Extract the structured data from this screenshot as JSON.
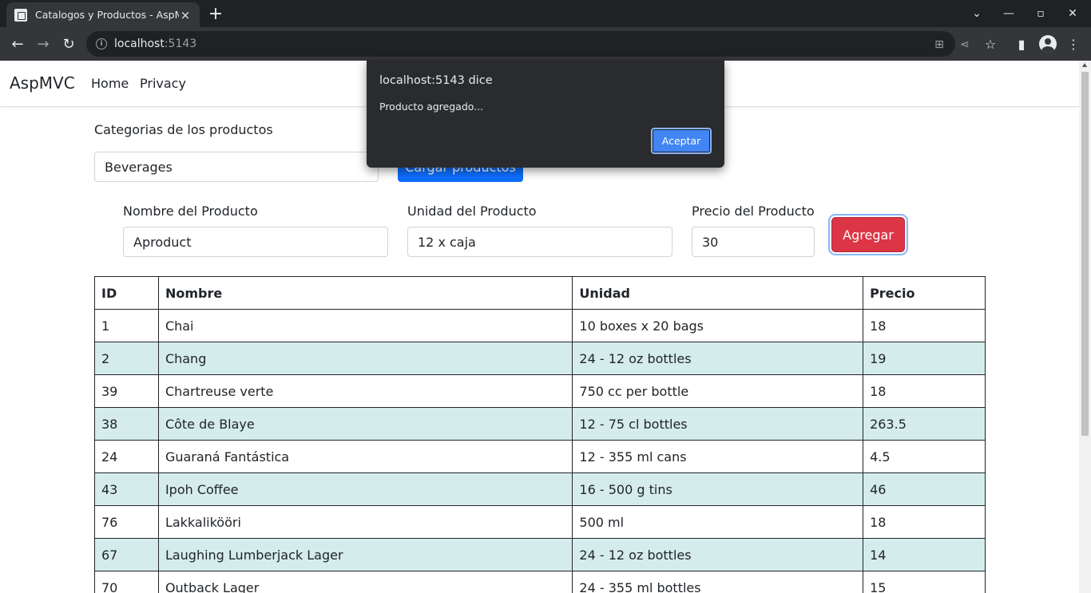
{
  "browser": {
    "tab_title": "Catalogos y Productos - AspMVC",
    "url_host": "localhost",
    "url_port": ":5143",
    "new_tab_symbol": "+",
    "tab_close_symbol": "×"
  },
  "navbar": {
    "brand": "AspMVC",
    "links": [
      "Home",
      "Privacy"
    ]
  },
  "category": {
    "label": "Categorias de los productos",
    "selected": "Beverages",
    "load_button": "Cargar productos"
  },
  "form": {
    "name_label": "Nombre del Producto",
    "name_value": "Aproduct",
    "unit_label": "Unidad del Producto",
    "unit_value": "12 x caja",
    "price_label": "Precio del Producto",
    "price_value": "30",
    "add_button": "Agregar"
  },
  "table": {
    "headers": [
      "ID",
      "Nombre",
      "Unidad",
      "Precio"
    ],
    "rows": [
      [
        "1",
        "Chai",
        "10 boxes x 20 bags",
        "18"
      ],
      [
        "2",
        "Chang",
        "24 - 12 oz bottles",
        "19"
      ],
      [
        "39",
        "Chartreuse verte",
        "750 cc per bottle",
        "18"
      ],
      [
        "38",
        "Côte de Blaye",
        "12 - 75 cl bottles",
        "263.5"
      ],
      [
        "24",
        "Guaraná Fantástica",
        "12 - 355 ml cans",
        "4.5"
      ],
      [
        "43",
        "Ipoh Coffee",
        "16 - 500 g tins",
        "46"
      ],
      [
        "76",
        "Lakkalikööri",
        "500 ml",
        "18"
      ],
      [
        "67",
        "Laughing Lumberjack Lager",
        "24 - 12 oz bottles",
        "14"
      ],
      [
        "70",
        "Outback Lager",
        "24 - 355 ml bottles",
        "15"
      ]
    ]
  },
  "dialog": {
    "title": "localhost:5143 dice",
    "message": "Producto agregado...",
    "ok_button": "Aceptar"
  },
  "colors": {
    "primary": "#0d6efd",
    "danger": "#dc3545",
    "row_alt": "#d5ecec",
    "dialog_button": "#4285f4"
  }
}
